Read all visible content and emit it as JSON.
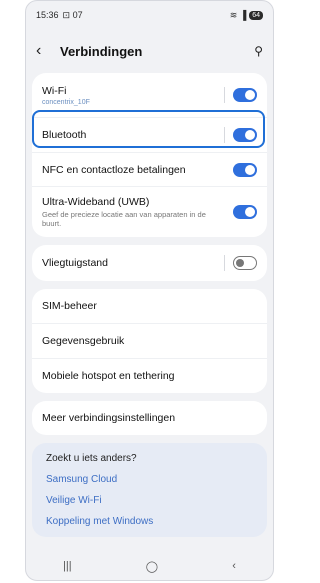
{
  "status": {
    "time": "15:36",
    "left_icons": "⊡ 07",
    "right_icons": "≋ ▐",
    "battery": "64"
  },
  "header": {
    "title": "Verbindingen"
  },
  "wifi": {
    "label": "Wi-Fi",
    "network": "concentrix_10F",
    "enabled": true
  },
  "bluetooth": {
    "label": "Bluetooth",
    "enabled": true
  },
  "nfc": {
    "label": "NFC en contactloze betalingen",
    "enabled": true
  },
  "uwb": {
    "label": "Ultra-Wideband (UWB)",
    "desc": "Geef de precieze locatie aan van apparaten in de buurt.",
    "enabled": true
  },
  "airplane": {
    "label": "Vliegtuigstand",
    "enabled": false
  },
  "sim": {
    "label": "SIM-beheer"
  },
  "data": {
    "label": "Gegevensgebruik"
  },
  "hotspot": {
    "label": "Mobiele hotspot en tethering"
  },
  "more": {
    "label": "Meer verbindingsinstellingen"
  },
  "suggest": {
    "heading": "Zoekt u iets anders?",
    "links": [
      "Samsung Cloud",
      "Veilige Wi-Fi",
      "Koppeling met Windows"
    ]
  },
  "nav": {
    "recents": "|||",
    "home": "◯",
    "back": "‹"
  },
  "colors": {
    "accent": "#2f6fdd",
    "highlight": "#1f6fd6"
  }
}
